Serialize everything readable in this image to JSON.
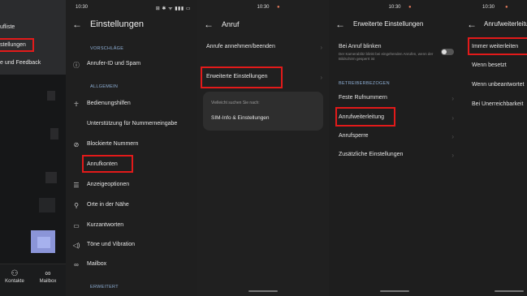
{
  "status": {
    "time": "10:30",
    "icons": "⊞ ✱ ᯤ ▮▮▮ ▭"
  },
  "panel1": {
    "menu_items": [
      "ufliste",
      "stellungen",
      "e und Feedback"
    ],
    "bottom_nav": {
      "contacts": "Kontakte",
      "mailbox": "Mailbox"
    }
  },
  "panel2": {
    "title": "Einstellungen",
    "section_suggestions": "VORSCHLÄGE",
    "caller_id": "Anrufer-ID und Spam",
    "section_general": "ALLGEMEIN",
    "items": [
      "Bedienungshilfen",
      "Unterstützung für Nummerneingabe",
      "Blockierte Nummern",
      "Anrufkonten",
      "Anzeigeoptionen",
      "Orte in der Nähe",
      "Kurzantworten",
      "Töne und Vibration",
      "Mailbox"
    ],
    "section_advanced": "ERWEITERT"
  },
  "panel3": {
    "title": "Anruf",
    "items": [
      "Anrufe annehmen/beenden",
      "Erweiterte Einstellungen"
    ],
    "card_hint": "Vielleicht suchen Sie nach:",
    "card_item": "SIM-Info & Einstellungen"
  },
  "panel4": {
    "title": "Erweiterte Einstellungen",
    "blink_label": "Bei Anruf blinken",
    "blink_sub": "Der Kamerablitz blinkt bei eingehenden Anrufen, wenn der Bildschirm gesperrt ist",
    "section_operator": "BETREIBERBEZOGEN",
    "items": [
      "Feste Rufnummern",
      "Anrufweiterleitung",
      "Anrufsperre",
      "Zusätzliche Einstellungen"
    ]
  },
  "panel5": {
    "title": "Anrufweiterleitu",
    "items": [
      "Immer weiterleiten",
      "Wenn besetzt",
      "Wenn unbeantwortet",
      "Bei Unerreichbarkeit"
    ]
  },
  "colors": {
    "highlight": "#e31a1a",
    "section": "#8fb0d6"
  }
}
